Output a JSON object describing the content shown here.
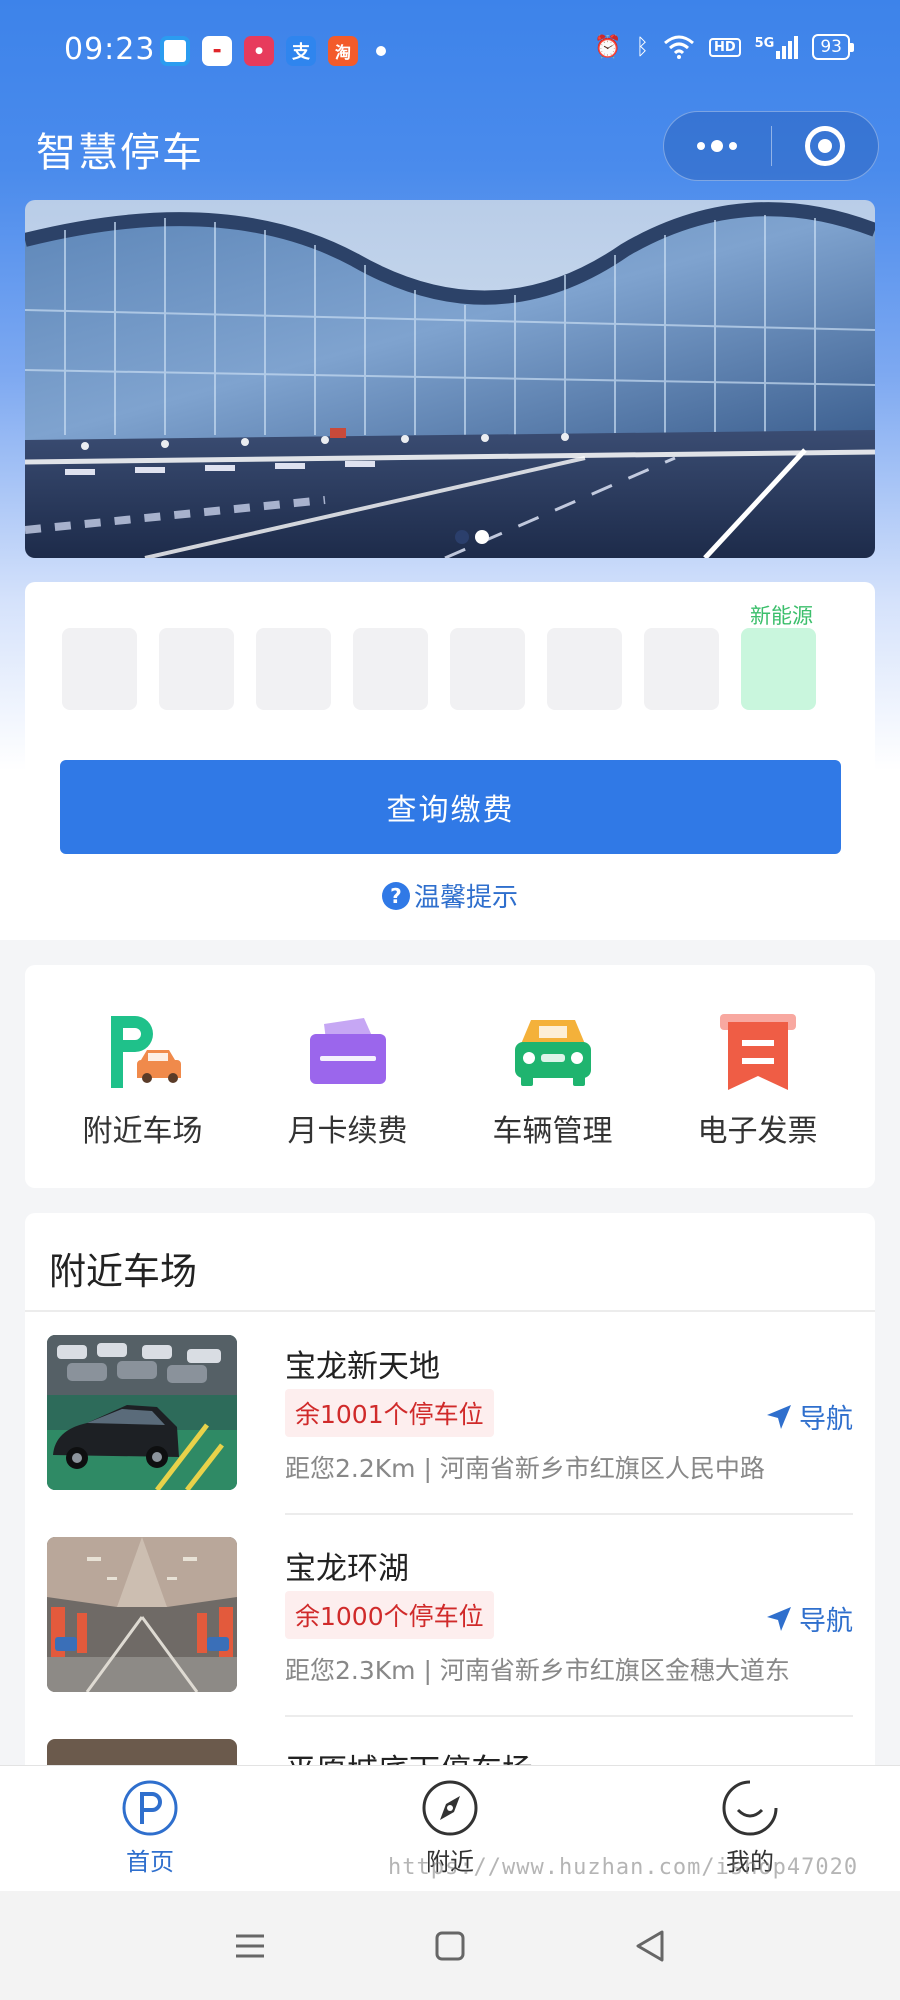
{
  "status_bar": {
    "time": "09:23",
    "notification_icons": [
      "blue-square-app-icon",
      "suning-app-icon",
      "xiaohongshu-app-icon",
      "alipay-app-icon",
      "taobao-app-icon"
    ],
    "signal_label": "5G",
    "hd_label": "HD",
    "battery": "93"
  },
  "header": {
    "title": "智慧停车",
    "capsule_more_icon": "more-dots-icon",
    "capsule_close_icon": "target-icon"
  },
  "banner": {
    "slide_count": 2,
    "active_index": 1
  },
  "plate_input": {
    "box_count": 8,
    "ev_label": "新能源",
    "query_button": "查询缴费",
    "tips_icon": "?",
    "tips_label": "温馨提示"
  },
  "quick_menu": {
    "items": [
      {
        "label": "附近车场",
        "icon": "parking-car-icon"
      },
      {
        "label": "月卡续费",
        "icon": "card-icon"
      },
      {
        "label": "车辆管理",
        "icon": "car-icon"
      },
      {
        "label": "电子发票",
        "icon": "invoice-icon"
      }
    ]
  },
  "nearby": {
    "title": "附近车场",
    "lots": [
      {
        "name": "宝龙新天地",
        "spaces": "余1001个停车位",
        "nav_label": "导航",
        "address": "距您2.2Km | 河南省新乡市红旗区人民中路"
      },
      {
        "name": "宝龙环湖",
        "spaces": "余1000个停车位",
        "nav_label": "导航",
        "address": "距您2.3Km | 河南省新乡市红旗区金穗大道东"
      },
      {
        "name": "平原城底下停车场",
        "spaces": "",
        "nav_label": "",
        "address": ""
      }
    ]
  },
  "tab_bar": {
    "tabs": [
      {
        "label": "首页",
        "icon": "parking-p-icon",
        "active": true
      },
      {
        "label": "附近",
        "icon": "compass-icon",
        "active": false
      },
      {
        "label": "我的",
        "icon": "smile-icon",
        "active": false
      }
    ]
  },
  "watermark": "https://www.huzhan.com/ishop47020",
  "colors": {
    "primary": "#3079e6",
    "accent_text": "#2f6fcd",
    "ev_green": "#3cbf6c",
    "spaces_red": "#d02a2a"
  }
}
